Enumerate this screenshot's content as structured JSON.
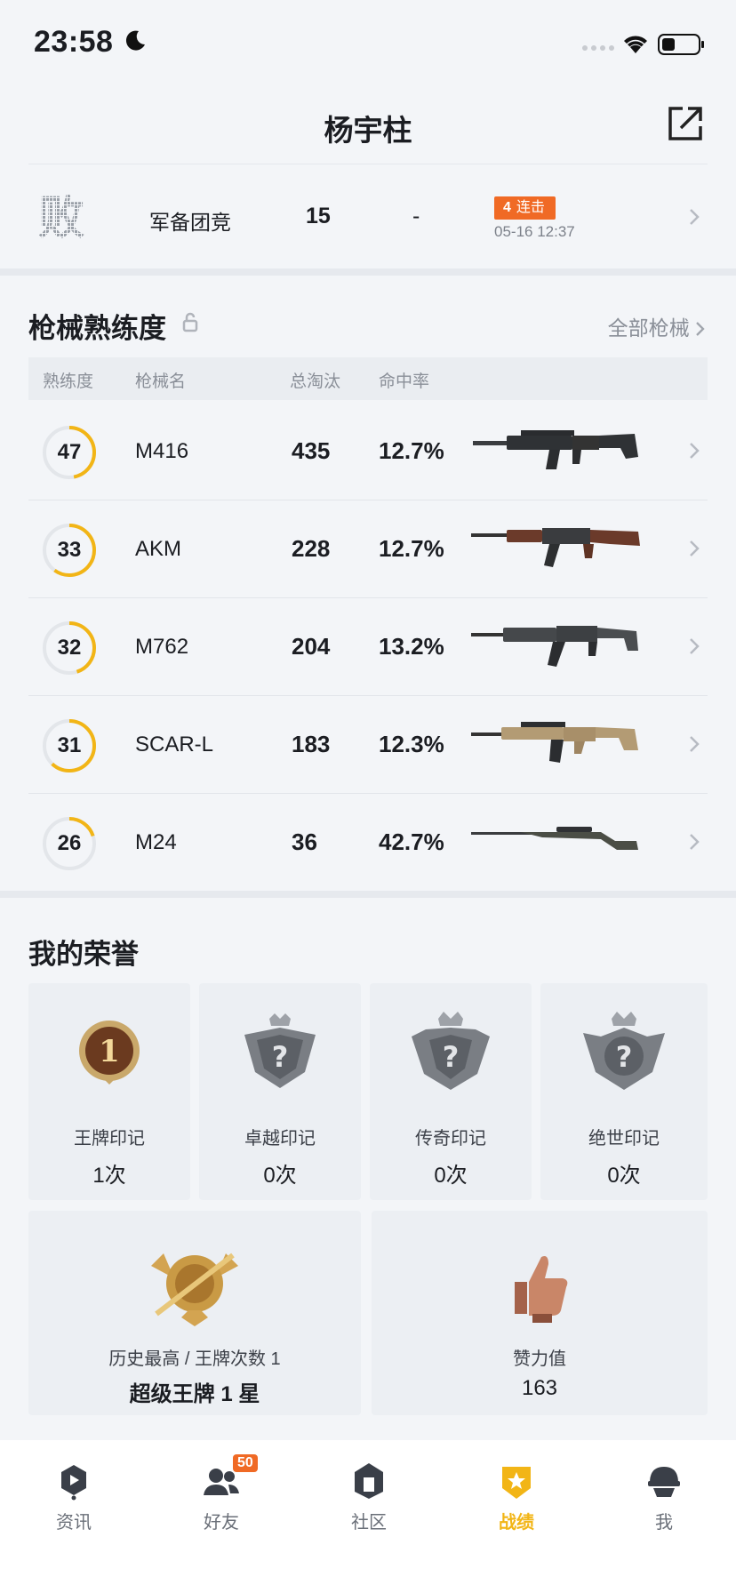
{
  "status": {
    "time": "23:58"
  },
  "header": {
    "title": "杨宇柱"
  },
  "last_match": {
    "result": "败",
    "mode": "军备团竞",
    "kills": "15",
    "rank": "-",
    "streak_count": "4",
    "streak_label": "连击",
    "time": "05-16 12:37"
  },
  "weapons": {
    "title": "枪械熟练度",
    "all_link": "全部枪械",
    "columns": [
      "熟练度",
      "枪械名",
      "总淘汰",
      "命中率"
    ],
    "rows": [
      {
        "proficiency": "47",
        "progress": 0.47,
        "name": "M416",
        "kills": "435",
        "rate": "12.7%"
      },
      {
        "proficiency": "33",
        "progress": 0.6,
        "name": "AKM",
        "kills": "228",
        "rate": "12.7%"
      },
      {
        "proficiency": "32",
        "progress": 0.45,
        "name": "M762",
        "kills": "204",
        "rate": "13.2%"
      },
      {
        "proficiency": "31",
        "progress": 0.62,
        "name": "SCAR-L",
        "kills": "183",
        "rate": "12.3%"
      },
      {
        "proficiency": "26",
        "progress": 0.2,
        "name": "M24",
        "kills": "36",
        "rate": "42.7%"
      }
    ]
  },
  "honors": {
    "title": "我的荣誉",
    "marks": [
      {
        "label": "王牌印记",
        "count": "1次"
      },
      {
        "label": "卓越印记",
        "count": "0次"
      },
      {
        "label": "传奇印记",
        "count": "0次"
      },
      {
        "label": "绝世印记",
        "count": "0次"
      }
    ],
    "highest": {
      "label": "历史最高 / 王牌次数 1",
      "value": "超级王牌 1 星"
    },
    "likes": {
      "label": "赞力值",
      "value": "163"
    }
  },
  "tabs": [
    {
      "label": "资讯",
      "icon": "news-icon"
    },
    {
      "label": "好友",
      "icon": "friends-icon",
      "badge": "50"
    },
    {
      "label": "社区",
      "icon": "community-icon"
    },
    {
      "label": "战绩",
      "icon": "record-icon",
      "active": true
    },
    {
      "label": "我",
      "icon": "profile-icon"
    }
  ],
  "colors": {
    "accent": "#f2b516",
    "streak": "#f06a25",
    "background": "#f3f5f8"
  }
}
